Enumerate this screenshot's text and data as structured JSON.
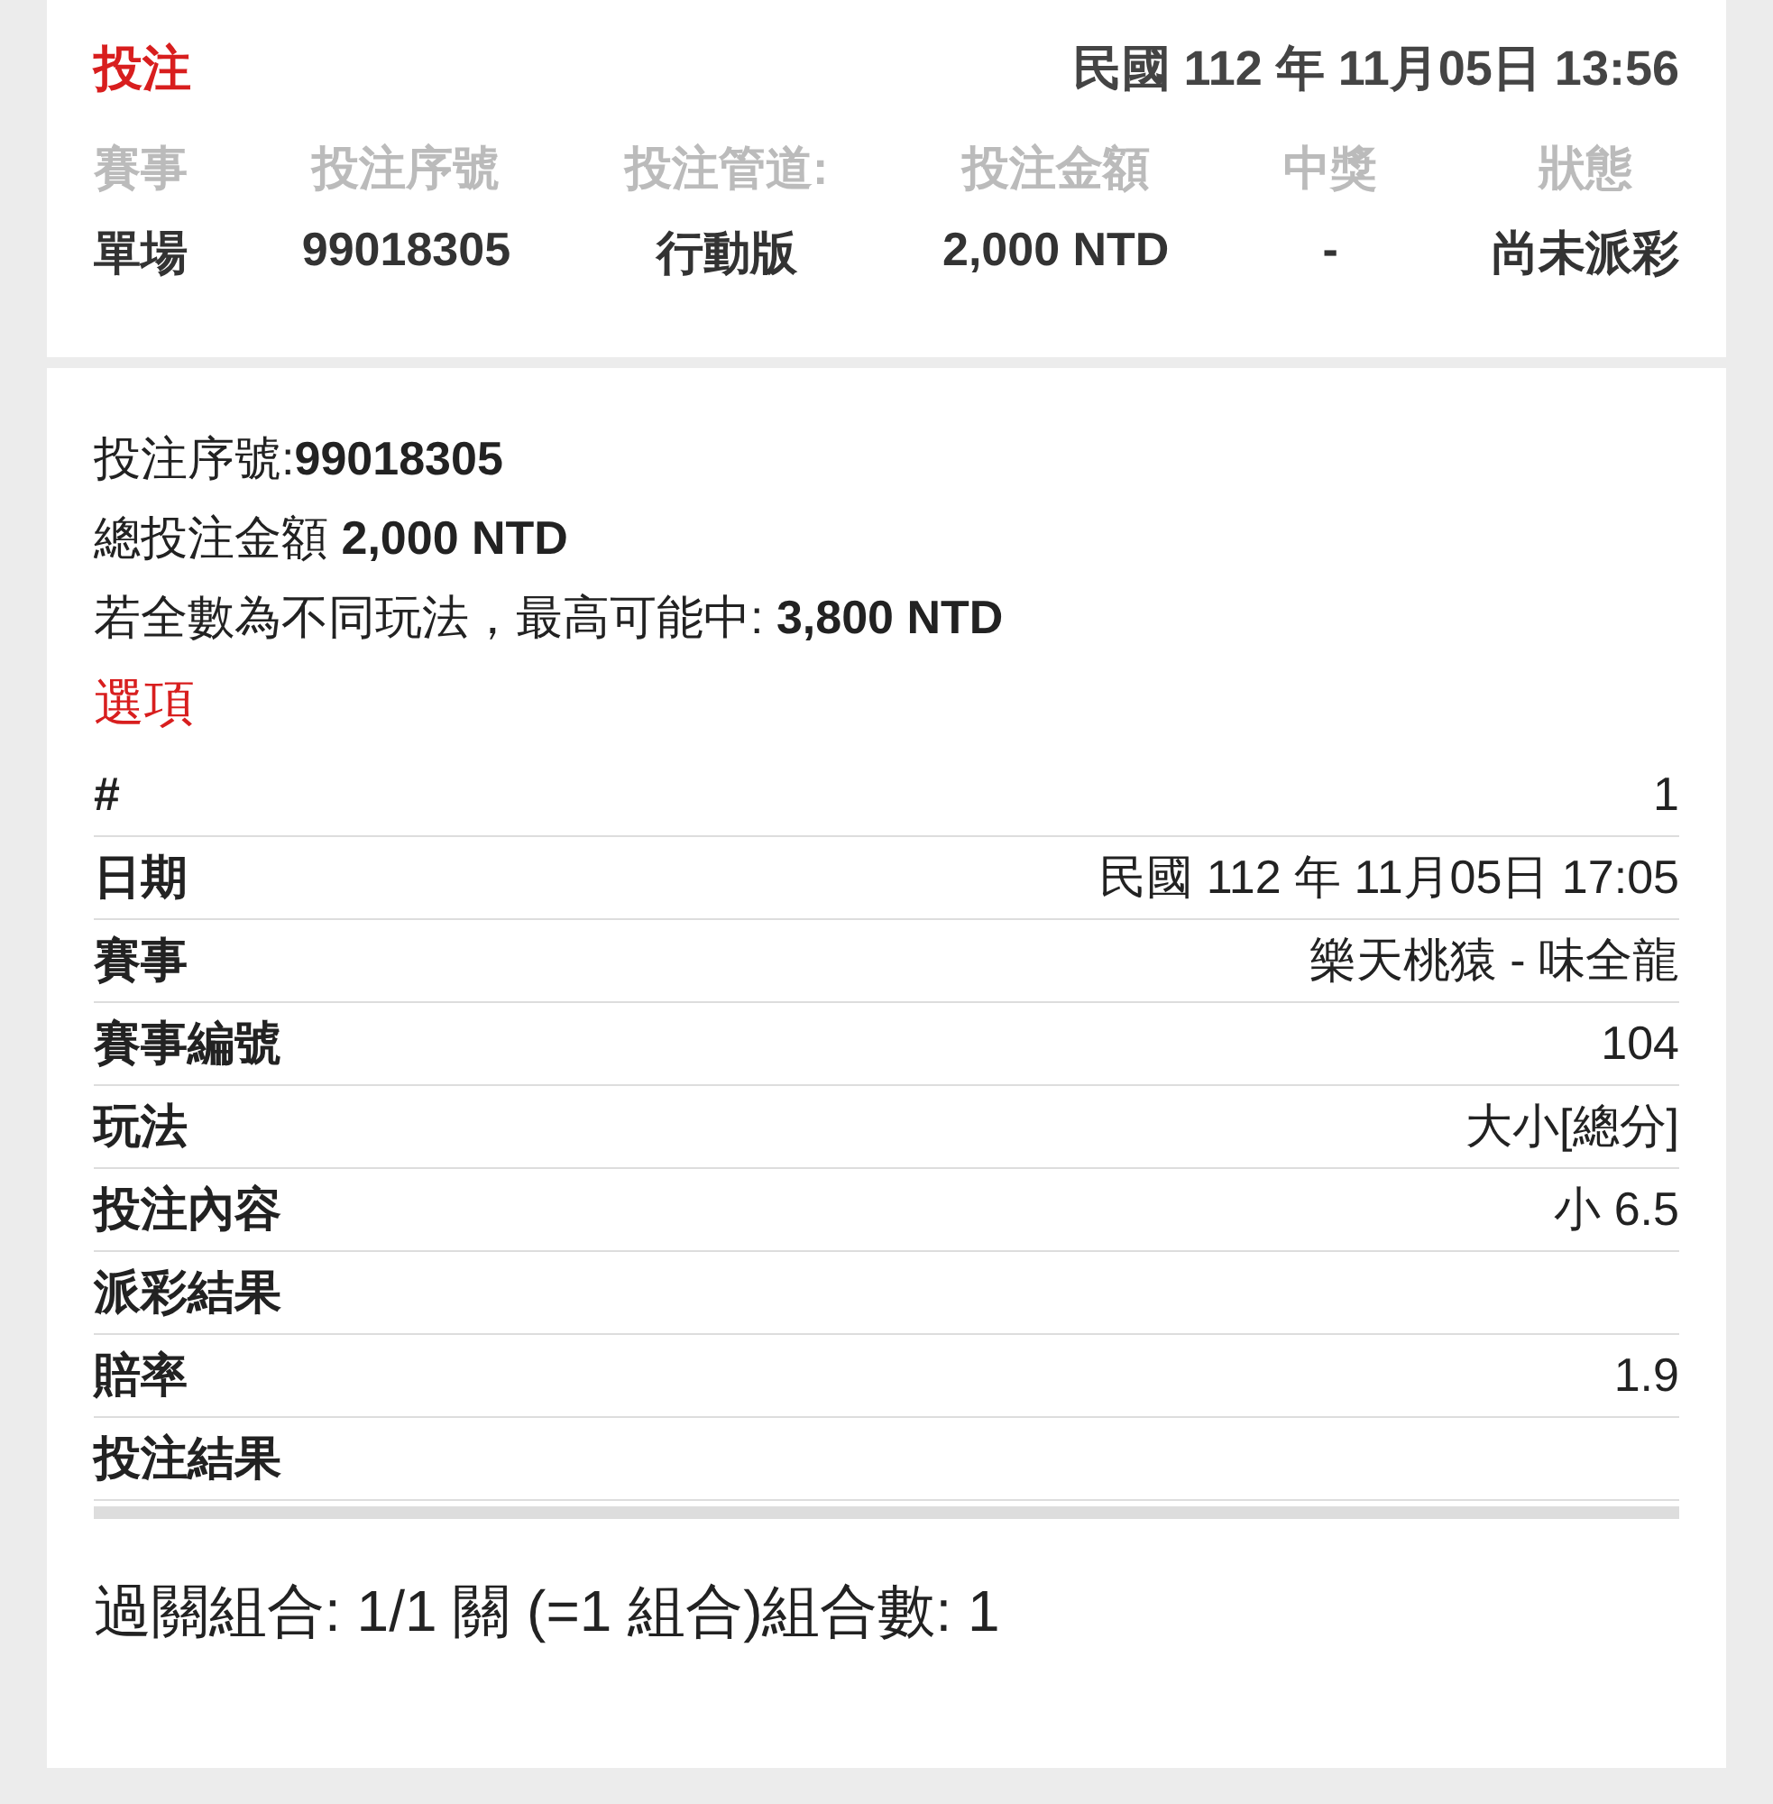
{
  "header": {
    "title": "投注",
    "datetime": "民國 112 年 11月05日 13:56"
  },
  "summary": [
    {
      "heading": "賽事",
      "value": "單場"
    },
    {
      "heading": "投注序號",
      "value": "99018305"
    },
    {
      "heading": "投注管道:",
      "value": "行動版"
    },
    {
      "heading": "投注金額",
      "value": "2,000 NTD"
    },
    {
      "heading": "中獎",
      "value": "-"
    },
    {
      "heading": "狀態",
      "value": "尚未派彩"
    }
  ],
  "details": [
    "投注序號:**99018305**",
    "總投注金額 **2,000 NTD**",
    "若全數為不同玩法，最高可能中: **3,800 NTD**"
  ],
  "options": {
    "title": "選項",
    "rows": [
      {
        "label": "#",
        "value": "1"
      },
      {
        "label": "日期",
        "value": "民國 112 年 11月05日 17:05"
      },
      {
        "label": "賽事",
        "value": "樂天桃猿 - 味全龍"
      },
      {
        "label": "賽事編號",
        "value": "104"
      },
      {
        "label": "玩法",
        "value": "大小[總分]"
      },
      {
        "label": "投注內容",
        "value": "小 6.5"
      },
      {
        "label": "派彩結果"
      },
      {
        "label": "賠率",
        "value": "1.9"
      },
      {
        "label": "投注結果"
      }
    ]
  },
  "footer": "過關組合: 1/1 關 (=1 組合)組合數: 1"
}
